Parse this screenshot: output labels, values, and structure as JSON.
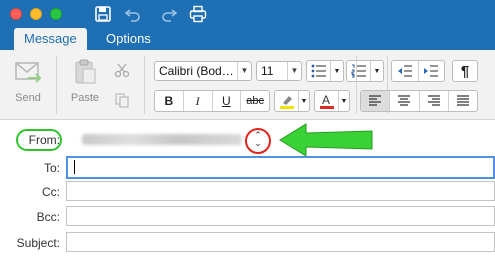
{
  "colors": {
    "titlebar": "#1e6fb4",
    "ribbon": "#f2f2f2",
    "annotation_green": "#2ec52b",
    "annotation_red": "#e0251b",
    "focus_border": "#4f93e0"
  },
  "tabs": [
    {
      "label": "Message",
      "active": true
    },
    {
      "label": "Options",
      "active": false
    }
  ],
  "ribbon": {
    "send_label": "Send",
    "paste_label": "Paste",
    "font_name": "Calibri (Bod…",
    "font_size": "11",
    "bold": "B",
    "italic": "I",
    "underline": "U",
    "strikethrough": "abc",
    "highlight_color": "#f3e400",
    "font_color": "#e02b20",
    "paragraph_mark": "¶"
  },
  "fields": {
    "from_label": "From:",
    "to_label": "To:",
    "cc_label": "Cc:",
    "bcc_label": "Bcc:",
    "subject_label": "Subject:"
  },
  "icons": {
    "save": "save-icon",
    "undo": "undo-icon",
    "redo": "redo-icon",
    "print": "print-icon",
    "send": "send-icon",
    "paste": "paste-icon",
    "cut": "scissors-icon",
    "copy": "copy-icon",
    "bullets": "bullets-icon",
    "numbering": "numbering-icon",
    "outdent": "decrease-indent-icon",
    "indent": "increase-indent-icon",
    "highlight": "highlighter-icon",
    "font_color": "font-color-icon",
    "align_left": "align-left-icon",
    "align_center": "align-center-icon",
    "align_right": "align-right-icon",
    "justify": "justify-icon",
    "from_stepper": "up-down-chevron-icon"
  }
}
